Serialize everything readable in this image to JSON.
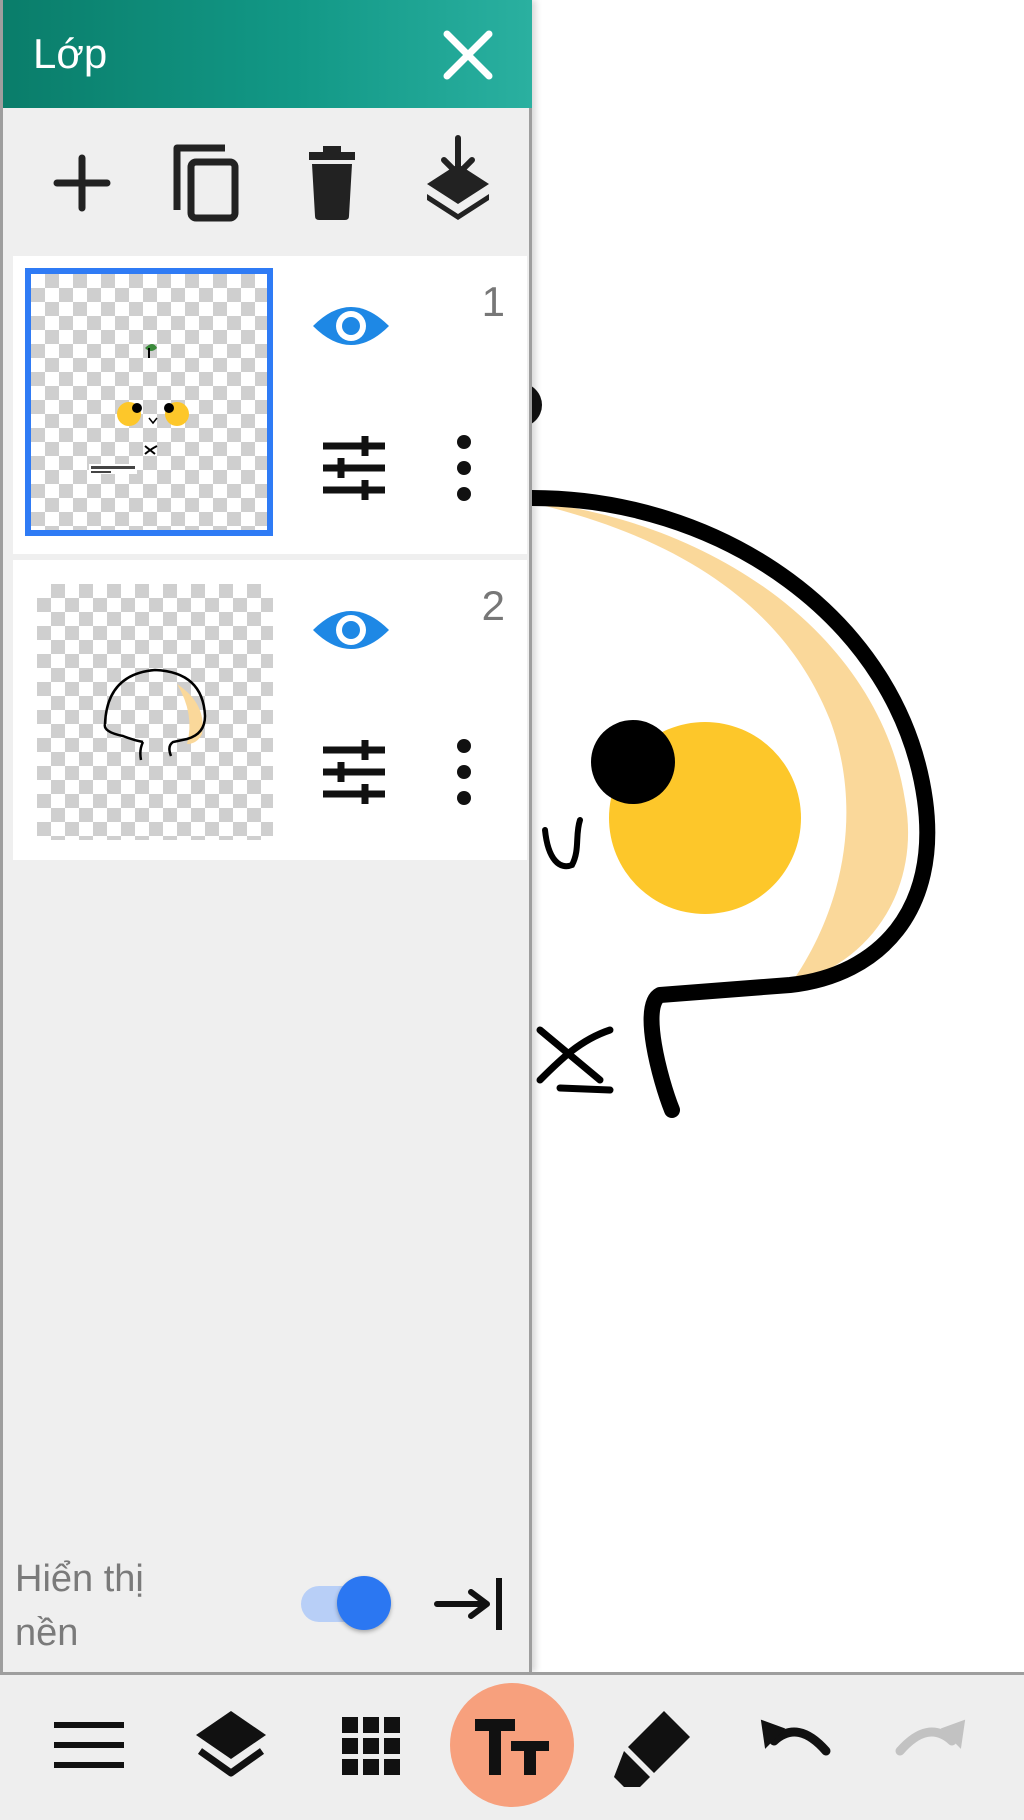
{
  "panel": {
    "title": "Lớp",
    "toolbar": [
      {
        "name": "add-layer",
        "icon": "plus-icon"
      },
      {
        "name": "duplicate-layer",
        "icon": "copy-icon"
      },
      {
        "name": "delete-layer",
        "icon": "trash-icon"
      },
      {
        "name": "merge-down",
        "icon": "merge-down-icon"
      }
    ],
    "layers": [
      {
        "number": "1",
        "selected": true,
        "visible": true
      },
      {
        "number": "2",
        "selected": false,
        "visible": true
      }
    ],
    "background_label": "Hiển thị nền",
    "background_visible": true
  },
  "bottom_toolbar": [
    {
      "name": "menu",
      "icon": "hamburger-icon"
    },
    {
      "name": "layers",
      "icon": "layers-icon"
    },
    {
      "name": "grid",
      "icon": "grid-icon"
    },
    {
      "name": "text-tool",
      "icon": "text-tool-icon",
      "active": true
    },
    {
      "name": "eraser",
      "icon": "eraser-icon"
    },
    {
      "name": "undo",
      "icon": "undo-icon"
    },
    {
      "name": "redo",
      "icon": "redo-icon",
      "enabled": false
    }
  ],
  "colors": {
    "header": "#129886",
    "accent_blue": "#2b77f2",
    "eye_blue": "#1e88e5",
    "active_tool_bg": "#f7a07d",
    "cheek_yellow": "#fdc72a",
    "shade_tan": "#fad89a"
  }
}
